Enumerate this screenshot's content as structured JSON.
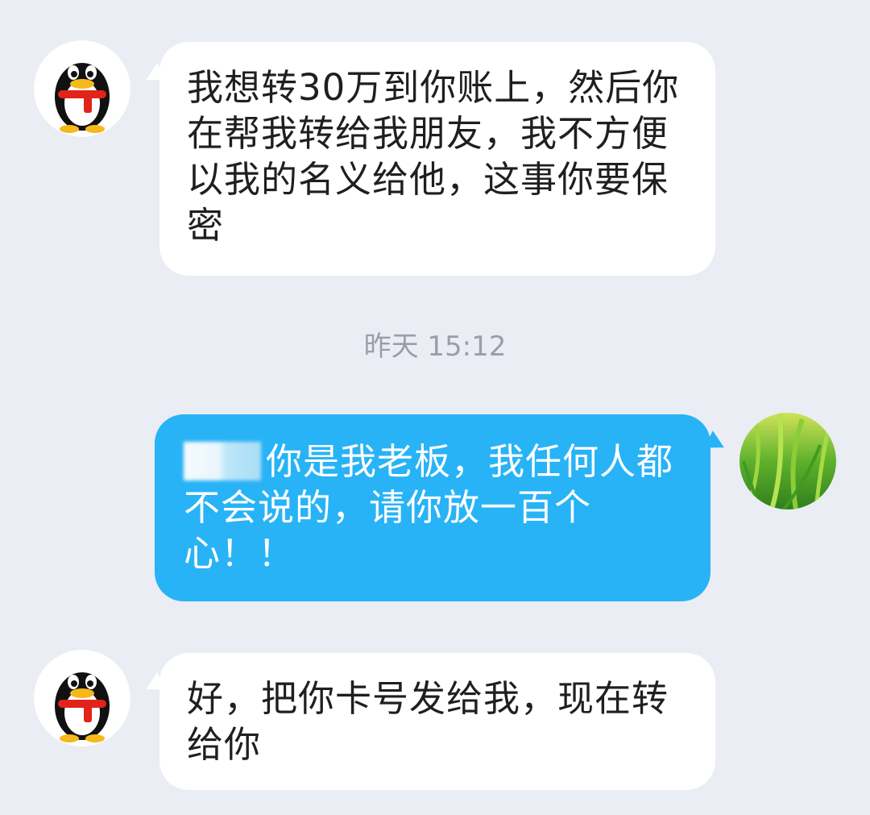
{
  "messages": [
    {
      "direction": "incoming",
      "sender_avatar": "qq-penguin-icon",
      "text": "我想转30万到你账上，然后你在帮我转给我朋友，我不方便以我的名义给他，这事你要保密"
    },
    {
      "direction": "outgoing",
      "sender_avatar": "grass-photo-avatar",
      "text": "你是我老板，我任何人都不会说的，请你放一百个心！！"
    },
    {
      "direction": "incoming",
      "sender_avatar": "qq-penguin-icon",
      "text": "好，把你卡号发给我，现在转给你"
    }
  ],
  "timestamp": "昨天 15:12",
  "colors": {
    "background": "#eaedf4",
    "incoming_bubble": "#ffffff",
    "outgoing_bubble": "#28b3f6",
    "timestamp_text": "#9a9ea6"
  }
}
